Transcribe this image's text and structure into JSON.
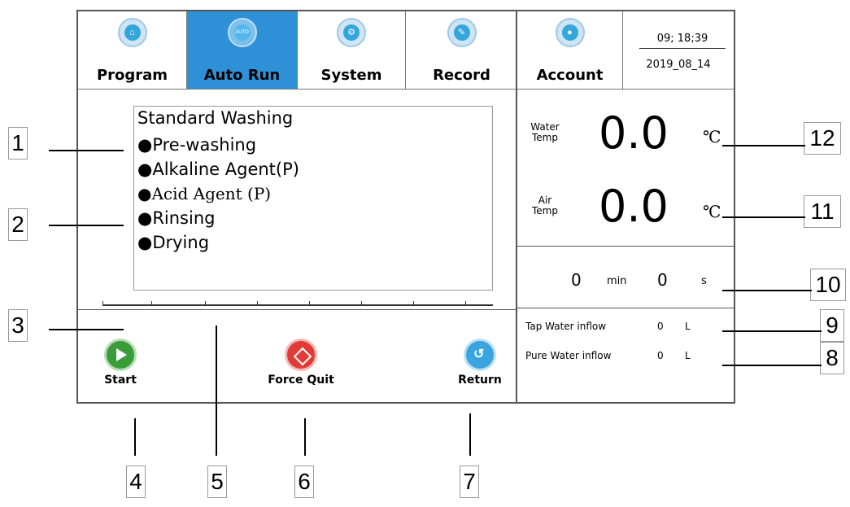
{
  "tabs": [
    {
      "label": "Program",
      "icon": "home-icon",
      "active": false
    },
    {
      "label": "Auto Run",
      "icon": "auto-icon",
      "icon_text": "AUTO",
      "active": true
    },
    {
      "label": "System",
      "icon": "gear-icon",
      "active": false
    },
    {
      "label": "Record",
      "icon": "pencil-icon",
      "active": false
    }
  ],
  "account": {
    "label": "Account",
    "icon": "user-icon"
  },
  "clock": {
    "time": "09; 18;39",
    "date": "2019_08_14"
  },
  "program": {
    "title": "Standard Washing",
    "steps": [
      "●Pre-washing",
      "●Alkaline Agent(P)",
      "●Acid Agent (P)",
      "●Rinsing",
      "●Drying"
    ]
  },
  "temps": {
    "water": {
      "label": "Water Temp",
      "value": "0.0",
      "unit": "℃"
    },
    "air": {
      "label": "Air Temp",
      "value": "0.0",
      "unit": "℃"
    }
  },
  "timer": {
    "min": "0",
    "min_unit": "min",
    "sec": "0",
    "sec_unit": "s"
  },
  "inflow": {
    "tap": {
      "label": "Tap Water inflow",
      "value": "0",
      "unit": "L"
    },
    "pure": {
      "label": "Pure Water inflow",
      "value": "0",
      "unit": "L"
    }
  },
  "buttons": {
    "start": "Start",
    "force_quit": "Force Quit",
    "return": "Return"
  },
  "colors": {
    "active_tab": "#2e91d8",
    "start": "#3a9d3a",
    "stop": "#e23b36",
    "return": "#3aa4de"
  },
  "callouts": [
    "1",
    "2",
    "3",
    "4",
    "5",
    "6",
    "7",
    "8",
    "9",
    "10",
    "11",
    "12"
  ]
}
